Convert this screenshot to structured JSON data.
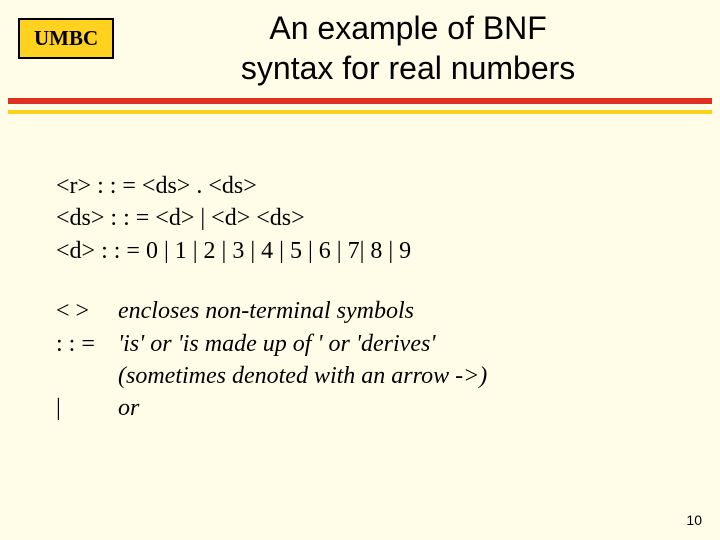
{
  "logo": "UMBC",
  "title_line1": "An example of BNF",
  "title_line2": "syntax for real numbers",
  "bnf": {
    "r": "<r>   : : =  <ds> . <ds>",
    "ds": "<ds> : : =  <d> | <d> <ds>",
    "d": "<d>  : : =  0 | 1 | 2 | 3 | 4 | 5 |  6 | 7|  8 | 9"
  },
  "legend": {
    "row1_sym": "< >",
    "row1_txt": "encloses non-terminal symbols",
    "row2_sym": ": : =",
    "row2_txt": "'is' or 'is made up of ' or 'derives'",
    "row2_sub": "(sometimes denoted with an arrow ->)",
    "row3_sym": "|",
    "row3_txt": "or"
  },
  "page_number": "10"
}
